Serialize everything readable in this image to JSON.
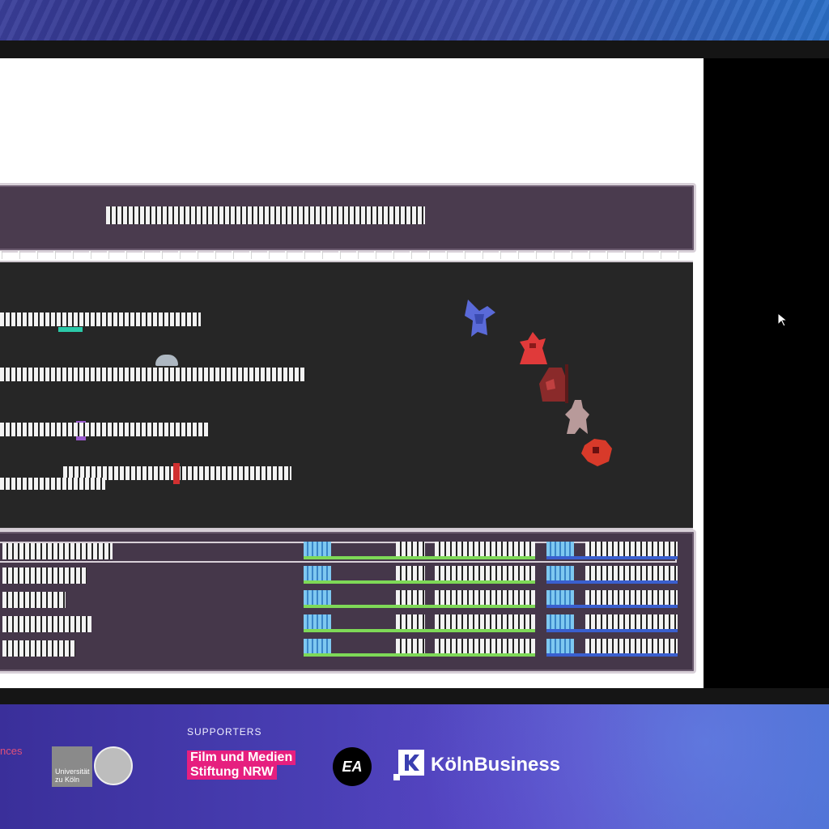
{
  "game": {
    "menu_rows": 5
  },
  "sponsors": {
    "supporters_label": "SUPPORTERS",
    "partner_fragment": "nces",
    "university_name_line1": "Universität",
    "university_name_line2": "zu Köln",
    "film_logo_line1": "Film und Medien",
    "film_logo_line2": "Stiftung NRW",
    "ea_logo": "EA",
    "koeln_business": "KölnBusiness"
  },
  "colors": {
    "banner": "#3a3f9a",
    "film_pink": "#e61f7f",
    "hp_green": "#7ed957",
    "mp_blue": "#3a5fcf"
  },
  "icons": [
    "mouse-cursor-icon",
    "university-seal-icon",
    "ea-logo-icon",
    "koelnbusiness-k-icon"
  ]
}
